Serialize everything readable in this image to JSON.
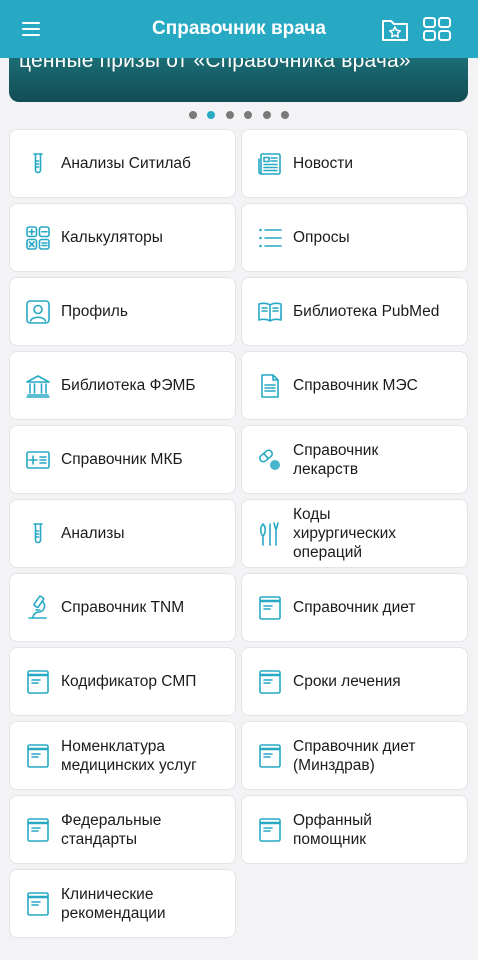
{
  "app": {
    "title": "Справочник врача",
    "accent": "#27a9c4",
    "icons": {
      "menu": "hamburger-icon",
      "favorites": "favorites-folder-icon",
      "grid": "grid-view-icon"
    }
  },
  "banner": {
    "text": "ценные призы от «Справочника врача»",
    "dots_total": 6,
    "active_dot": 2
  },
  "tiles": [
    {
      "label": "Анализы Ситилаб",
      "icon": "test-tube-icon"
    },
    {
      "label": "Новости",
      "icon": "newspaper-icon"
    },
    {
      "label": "Калькуляторы",
      "icon": "calculator-icon"
    },
    {
      "label": "Опросы",
      "icon": "list-icon"
    },
    {
      "label": "Профиль",
      "icon": "profile-icon"
    },
    {
      "label": "Библиотека PubMed",
      "icon": "book-icon"
    },
    {
      "label": "Библиотека ФЭМБ",
      "icon": "library-building-icon"
    },
    {
      "label": "Справочник МЭС",
      "icon": "document-icon"
    },
    {
      "label": "Справочник МКБ",
      "icon": "medical-card-icon"
    },
    {
      "label": "Справочник\nлекарств",
      "icon": "pills-icon"
    },
    {
      "label": "Анализы",
      "icon": "test-tube-icon"
    },
    {
      "label": "Коды\nхирургических\nопераций",
      "icon": "surgical-tools-icon"
    },
    {
      "label": "Справочник TNM",
      "icon": "microscope-icon"
    },
    {
      "label": "Справочник диет",
      "icon": "folder-doc-icon"
    },
    {
      "label": "Кодификатор СМП",
      "icon": "folder-doc-icon"
    },
    {
      "label": "Сроки лечения",
      "icon": "folder-doc-icon"
    },
    {
      "label": "Номенклатура\nмедицинских услуг",
      "icon": "folder-doc-icon"
    },
    {
      "label": "Справочник диет\n(Минздрав)",
      "icon": "folder-doc-icon"
    },
    {
      "label": "Федеральные\nстандарты",
      "icon": "folder-doc-icon"
    },
    {
      "label": "Орфанный\nпомощник",
      "icon": "folder-doc-icon"
    },
    {
      "label": "Клинические\nрекомендации",
      "icon": "folder-doc-icon"
    }
  ]
}
